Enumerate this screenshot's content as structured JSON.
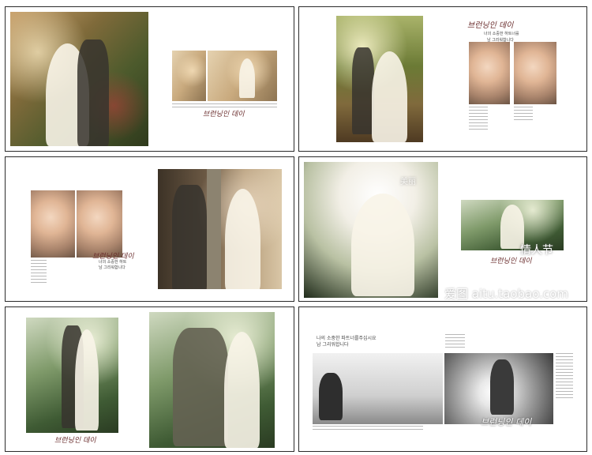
{
  "watermark": "爱图 aitu.taobao.com",
  "panels": [
    {
      "name": "page-1",
      "script": "브런닝인 데이"
    },
    {
      "name": "page-2",
      "script": "브런닝인 데이",
      "sub_lines": [
        "너의 소중한 하트너를",
        "남 그리워합니다"
      ]
    },
    {
      "name": "page-3",
      "script": "브런닝인 데이",
      "sub_lines": [
        "너의 소중한 하트",
        "남 그리워합니다"
      ]
    },
    {
      "name": "page-4",
      "script": "브런닝인 데이",
      "overlay_text": "情人节",
      "overlay_text2": "美丽"
    },
    {
      "name": "page-5",
      "script": "브런닝인 데이"
    },
    {
      "name": "page-6",
      "script": "브런닝인 데이",
      "header_line1": "나의 소중한 파트너를주십시요",
      "header_line2": "남 그리워합니다"
    }
  ]
}
